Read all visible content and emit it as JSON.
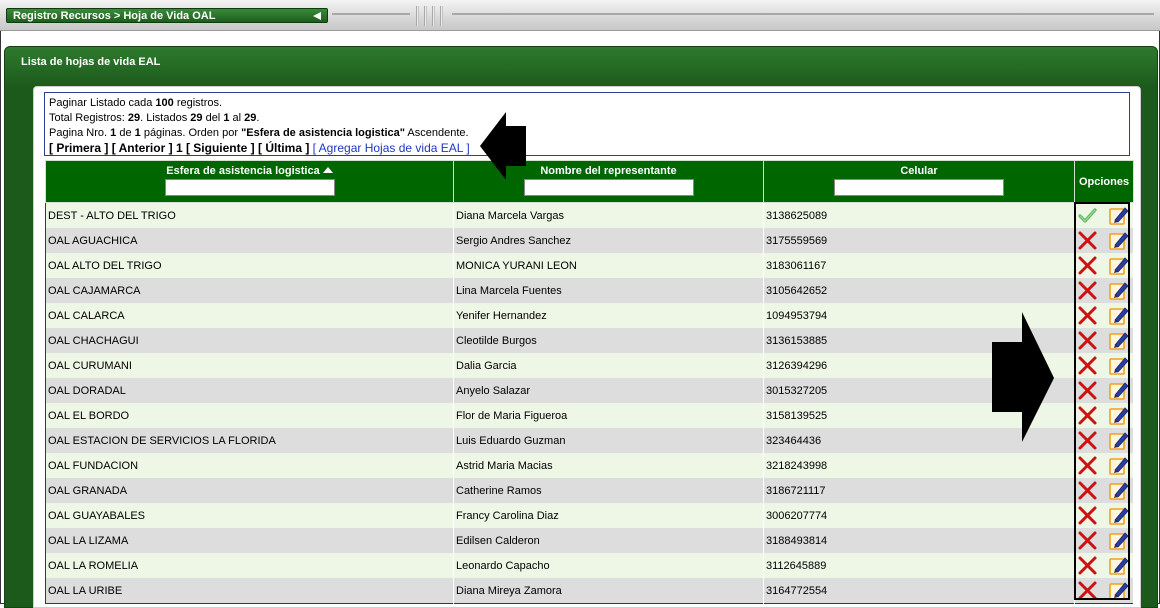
{
  "breadcrumb": "Registro Recursos > Hoja de Vida OAL",
  "panel_title": "Lista de hojas de vida EAL",
  "info": {
    "line1_pre": "Paginar Listado cada ",
    "line1_num": "100",
    "line1_post": " registros.",
    "line2_a": "Total Registros: ",
    "line2_total": "29",
    "line2_b": ". Listados ",
    "line2_listed": "29",
    "line2_c": " del ",
    "line2_from": "1",
    "line2_d": " al ",
    "line2_to": "29",
    "line2_e": ".",
    "line3_a": "Pagina Nro. ",
    "line3_page": "1",
    "line3_b": " de ",
    "line3_pages": "1",
    "line3_c": " páginas. Orden por ",
    "line3_order": "\"Esfera de asistencia logistica\"",
    "line3_d": " Ascendente."
  },
  "pager": {
    "first": "[ Primera ]",
    "prev": "[ Anterior ]",
    "current": "1",
    "next": "[ Siguiente ]",
    "last": "[ Última ]",
    "add": "[ Agregar Hojas de vida EAL ]"
  },
  "columns": {
    "esfera": "Esfera de asistencia logistica",
    "nombre": "Nombre del representante",
    "celular": "Celular",
    "opciones": "Opciones"
  },
  "rows": [
    {
      "esfera": "DEST - ALTO DEL TRIGO",
      "nombre": "Diana Marcela Vargas",
      "celular": "3138625089",
      "status": "check"
    },
    {
      "esfera": "OAL AGUACHICA",
      "nombre": "Sergio Andres Sanchez",
      "celular": "3175559569",
      "status": "x"
    },
    {
      "esfera": "OAL ALTO DEL TRIGO",
      "nombre": "MONICA YURANI LEON",
      "celular": "3183061167",
      "status": "x"
    },
    {
      "esfera": "OAL CAJAMARCA",
      "nombre": "Lina Marcela Fuentes",
      "celular": "3105642652",
      "status": "x"
    },
    {
      "esfera": "OAL CALARCA",
      "nombre": "Yenifer Hernandez",
      "celular": "1094953794",
      "status": "x"
    },
    {
      "esfera": "OAL CHACHAGUI",
      "nombre": "Cleotilde Burgos",
      "celular": "3136153885",
      "status": "x"
    },
    {
      "esfera": "OAL CURUMANI",
      "nombre": "Dalia Garcia",
      "celular": "3126394296",
      "status": "x"
    },
    {
      "esfera": "OAL DORADAL",
      "nombre": "Anyelo Salazar",
      "celular": "3015327205",
      "status": "x"
    },
    {
      "esfera": "OAL EL BORDO",
      "nombre": "Flor de Maria Figueroa",
      "celular": "3158139525",
      "status": "x"
    },
    {
      "esfera": "OAL ESTACION DE SERVICIOS LA FLORIDA",
      "nombre": "Luis Eduardo Guzman",
      "celular": "323464436",
      "status": "x"
    },
    {
      "esfera": "OAL FUNDACION",
      "nombre": "Astrid Maria Macias",
      "celular": "3218243998",
      "status": "x"
    },
    {
      "esfera": "OAL GRANADA",
      "nombre": "Catherine Ramos",
      "celular": "3186721117",
      "status": "x"
    },
    {
      "esfera": "OAL GUAYABALES",
      "nombre": "Francy Carolina Diaz",
      "celular": "3006207774",
      "status": "x"
    },
    {
      "esfera": "OAL LA LIZAMA",
      "nombre": "Edilsen Calderon",
      "celular": "3188493814",
      "status": "x"
    },
    {
      "esfera": "OAL LA ROMELIA",
      "nombre": "Leonardo Capacho",
      "celular": "3112645889",
      "status": "x"
    },
    {
      "esfera": "OAL LA URIBE",
      "nombre": "Diana Mireya Zamora",
      "celular": "3164772554",
      "status": "x"
    }
  ],
  "icons": {
    "check": "check-icon",
    "x": "delete-x-icon",
    "edit": "edit-icon"
  },
  "colors": {
    "header_green": "#006600",
    "row_light": "#eef6e6",
    "row_gray": "#dddddd",
    "link_blue": "#1f36c2",
    "delete_red": "#cc1111",
    "check_green": "#5cb85c"
  }
}
